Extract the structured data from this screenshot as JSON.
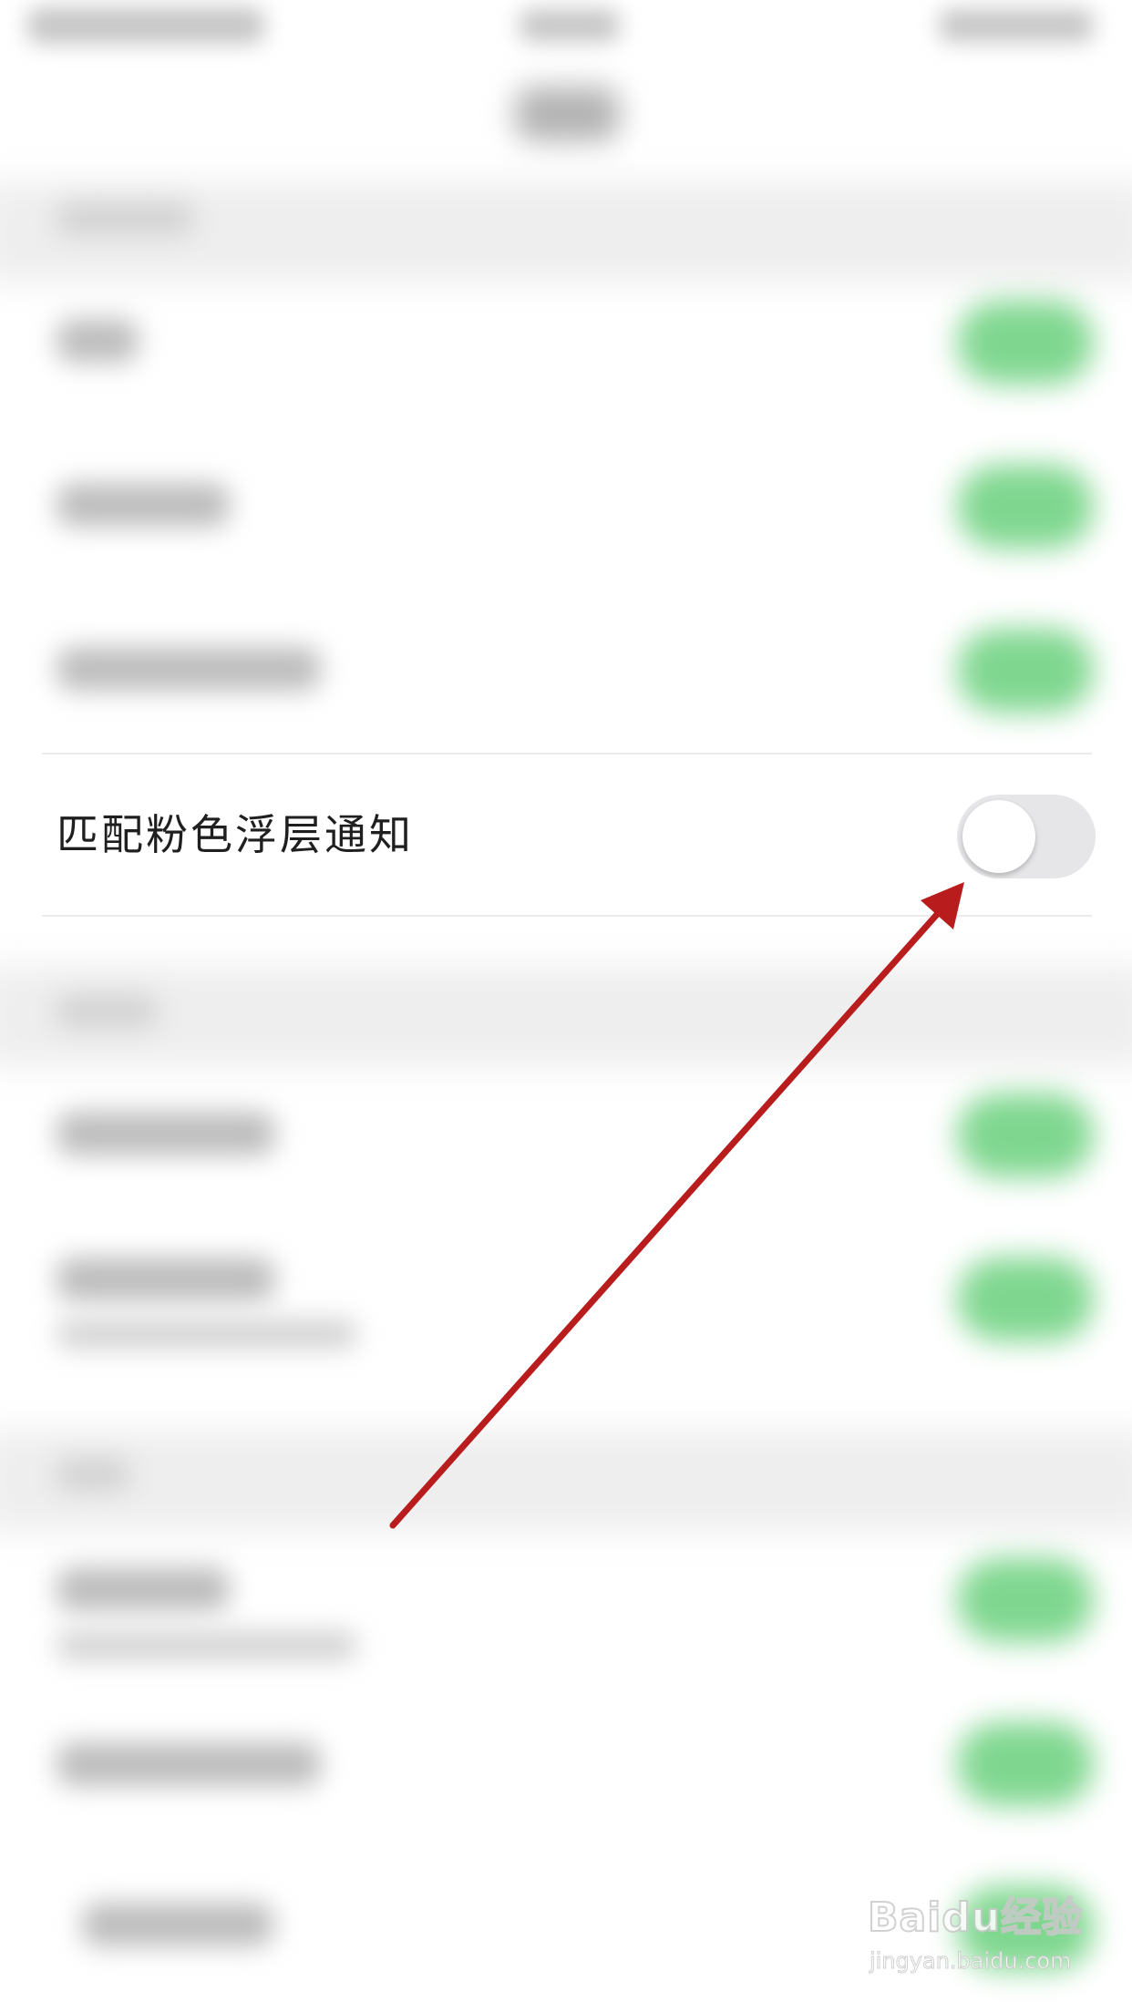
{
  "settings": {
    "highlighted_item": {
      "label": "匹配粉色浮层通知",
      "toggle_state": "off"
    }
  },
  "colors": {
    "toggle_on": "#69d07c",
    "toggle_off": "#e6e6e8",
    "annotation_arrow": "#b81c1c"
  },
  "watermark": {
    "logo": "Baidu经验",
    "url": "jingyan.baidu.com"
  }
}
